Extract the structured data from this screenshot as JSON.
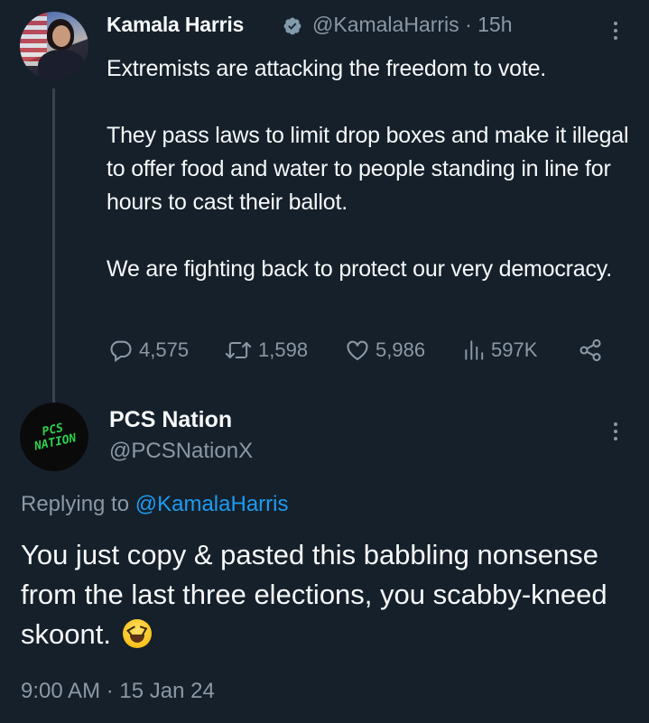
{
  "tweet": {
    "author_name": "Kamala Harris",
    "handle": "@KamalaHarris",
    "separator": "·",
    "time_ago": "15h",
    "paragraphs": [
      "Extremists are attacking the freedom to vote.",
      "They pass laws to limit drop boxes and make it illegal to offer food and water to people standing in line for hours to cast their ballot.",
      "We are fighting back to protect our very democracy."
    ],
    "stats": {
      "replies": "4,575",
      "reposts": "1,598",
      "likes": "5,986",
      "views": "597K"
    },
    "verified_badge_color": "#829aab",
    "icons": [
      "verified-badge-icon",
      "more-options-icon",
      "reply-icon",
      "repost-icon",
      "like-icon",
      "views-icon",
      "share-icon"
    ]
  },
  "reply": {
    "author_name": "PCS Nation",
    "handle": "@PCSNationX",
    "avatar_text": "PCS NATION",
    "replying_prefix": "Replying to",
    "replying_mention": "@KamalaHarris",
    "text": "You just copy & pasted this babbling nonsense from the last three elections, you scabby-kneed skoont.",
    "emoji": "grinning-squinting-face",
    "timestamp": "9:00 AM · 15 Jan 24"
  },
  "colors": {
    "background": "#15202b",
    "text_primary": "#f7f9f9",
    "text_secondary": "#8b98a5",
    "link": "#1d9bf0",
    "thread_line": "#38444d",
    "logo_green": "#2fd04a"
  }
}
